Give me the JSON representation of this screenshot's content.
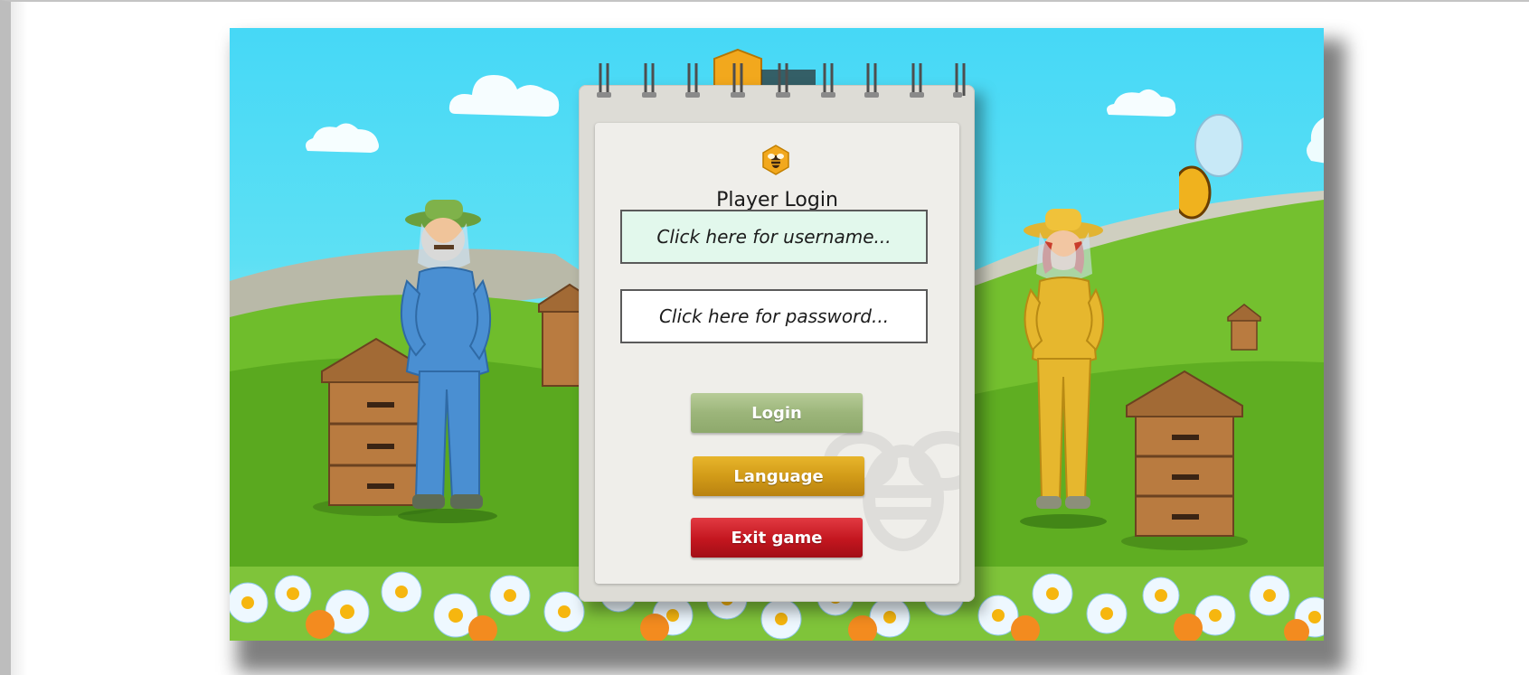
{
  "login_panel": {
    "title": "Player Login",
    "username_placeholder": "Click here for username...",
    "password_placeholder": "Click here for password...",
    "buttons": {
      "login": "Login",
      "language": "Language",
      "exit": "Exit game"
    }
  },
  "colors": {
    "sky": "#46d8f6",
    "grass": "#6fbd2c",
    "login_button": "#9cb57a",
    "language_button": "#d29b18",
    "exit_button": "#c3161f",
    "username_field_bg": "#e2f8ec",
    "logo_hexagon": "#f2a81d"
  },
  "icons": [
    "bee-hexagon-icon",
    "bee-watermark-icon"
  ]
}
